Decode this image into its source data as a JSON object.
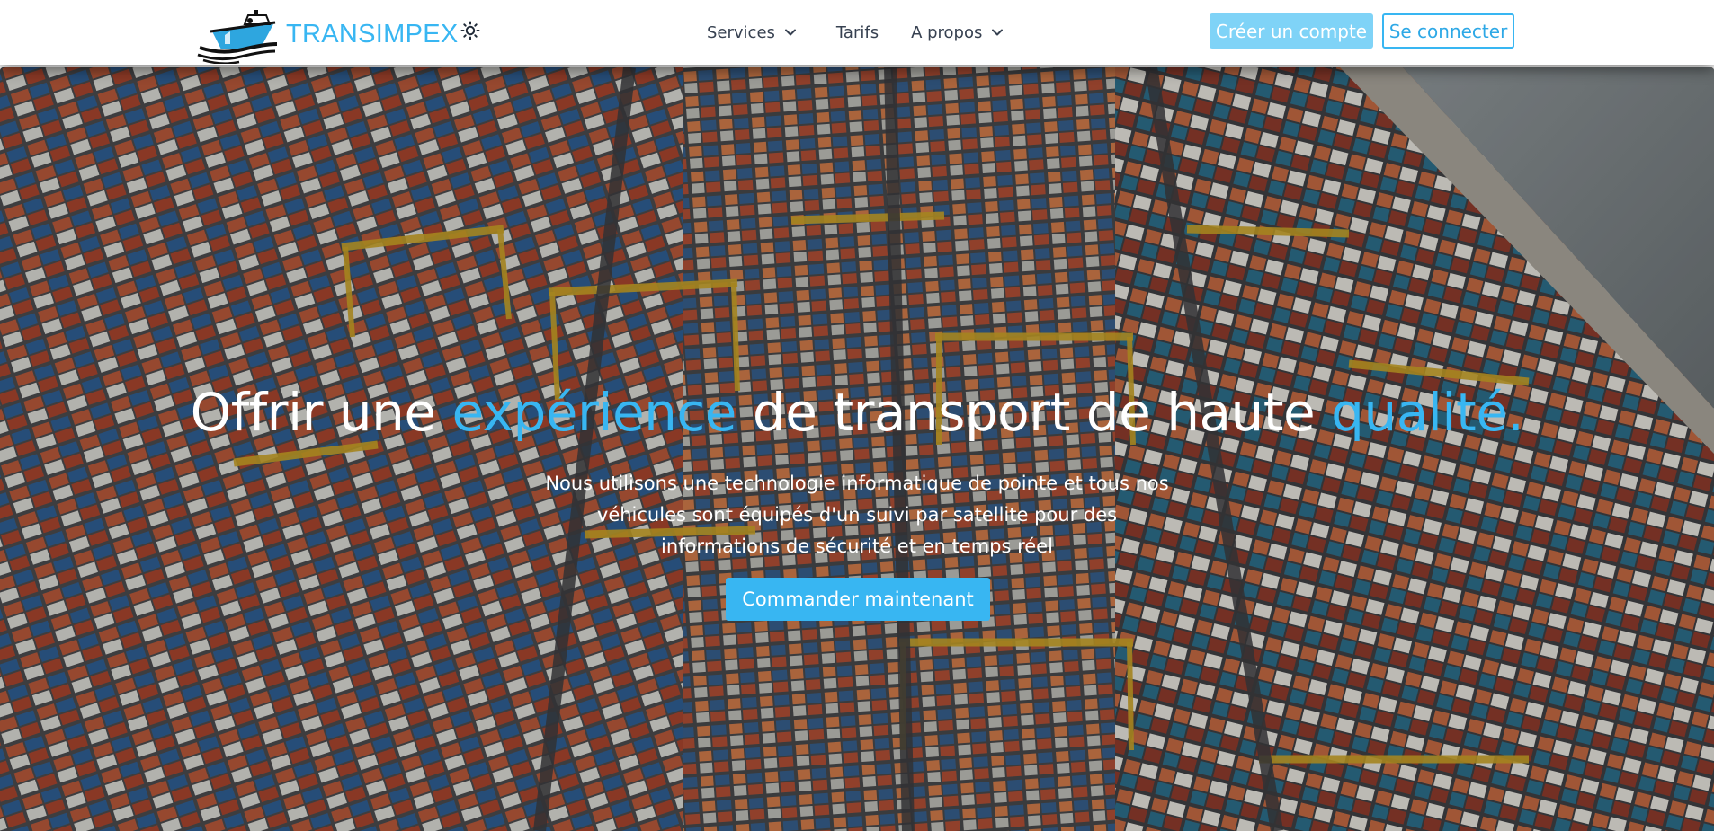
{
  "navbar": {
    "brand_name": "TRANSIMPEX",
    "logo_icon": "cargo-ship-logo",
    "theme_toggle_icon": "sun-icon",
    "links": [
      {
        "label": "Services",
        "has_dropdown": true
      },
      {
        "label": "Tarifs",
        "has_dropdown": false
      },
      {
        "label": "A propos",
        "has_dropdown": true
      }
    ],
    "register_label": "Créer un compte",
    "login_label": "Se connecter"
  },
  "hero": {
    "background": "container-port-aerial-photo",
    "headline": {
      "part1": "Offrir une ",
      "accent1": "expérience",
      "part2": " de transport de haute ",
      "accent2": "qualité."
    },
    "subtitle": "Nous utilisons une technologie informatique de pointe et tous nos véhicules sont équipés d'un suivi par satellite pour des informations de sécurité et en temps réel",
    "cta_label": "Commander maintenant"
  },
  "colors": {
    "accent": "#38b6f2",
    "register_button": "#7fd3f7",
    "nav_text": "#374151",
    "white": "#ffffff"
  }
}
